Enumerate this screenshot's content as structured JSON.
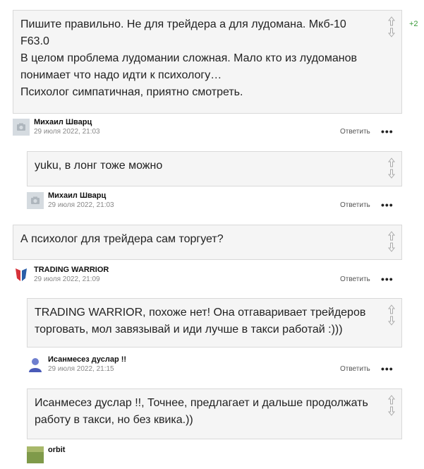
{
  "comments": [
    {
      "text_lines": [
        "Пишите правильно. Не для трейдера а для лудомана. Мкб-10",
        "F63.0",
        "В целом проблема лудомании сложная. Мало кто из лудоманов",
        "понимает что надо идти к психологу…",
        "Психолог симпатичная, приятно смотреть."
      ],
      "score": "+2",
      "author": "Михаил Шварц",
      "date": "29 июля 2022, 21:03",
      "reply_label": "Ответить",
      "avatar": "camera-placeholder-icon"
    },
    {
      "text_lines": [
        "yuku, в лонг тоже можно"
      ],
      "author": "Михаил Шварц",
      "date": "29 июля 2022, 21:03",
      "reply_label": "Ответить",
      "avatar": "camera-placeholder-icon"
    },
    {
      "text_lines": [
        "А психолог для трейдера сам торгует?"
      ],
      "author": "TRADING WARRIOR",
      "date": "29 июля 2022, 21:09",
      "reply_label": "Ответить",
      "avatar": "shield-logo-icon"
    },
    {
      "text_lines": [
        "TRADING WARRIOR, похоже нет! Она отгаваривает трейдеров",
        "торговать, мол завязывай и иди лучше в такси работай :)))"
      ],
      "author": "Исанмесез дуслар !!",
      "date": "29 июля 2022, 21:15",
      "reply_label": "Ответить",
      "avatar": "user-silhouette-icon"
    },
    {
      "text_lines": [
        "Исанмесез дуслар !!, Точнее, предлагает и дальше продолжать",
        "работу в такси, но без квика.))"
      ],
      "author": "orbit",
      "avatar": "photo-avatar-icon"
    }
  ],
  "more_label": "•••",
  "colors": {
    "score_positive": "#3a9a3a",
    "bubble_bg": "#f5f5f5",
    "bubble_border": "#d9d9d9"
  }
}
